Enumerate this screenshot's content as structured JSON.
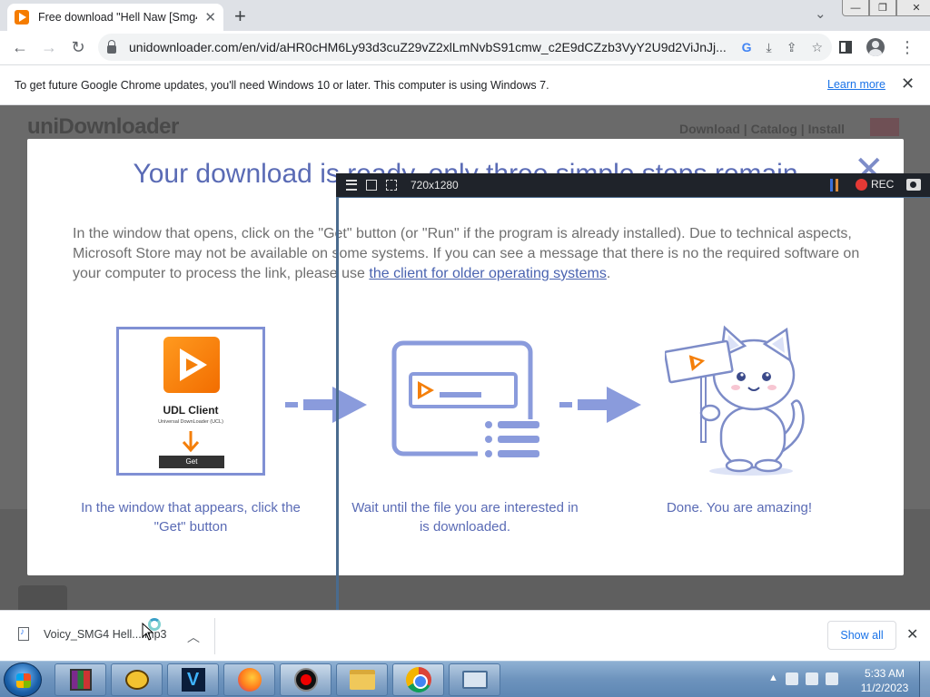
{
  "browser": {
    "tab_title": "Free download \"Hell Naw [Smg4",
    "url": "unidownloader.com/en/vid/aHR0cHM6Ly93d3cuZ29vZ2xlLmNvbS91cmw_c2E9dCZzb3VyY2U9d2ViJnJj...",
    "infobar_text": "To get future Google Chrome updates, you'll need Windows 10 or later. This computer is using Windows 7.",
    "infobar_link": "Learn more"
  },
  "site": {
    "logo": "uniDownloader",
    "nav": "Download | Catalog | Install"
  },
  "modal": {
    "title": "Your download is ready, only three simple steps remain",
    "description": "In the window that opens, click on the \"Get\" button (or \"Run\" if the program is already installed). Due to technical aspects, Microsoft Store may not be available on some systems. If you can see a message that there is no the required software on your computer to process the link, please use ",
    "description_link": "the client for older operating systems",
    "description_end": ".",
    "udl_title": "UDL Client",
    "udl_subtitle": "Universal DownLoader (UCL)",
    "udl_get": "Get",
    "step1_line1": "In the window that appears, click the",
    "step1_line2": "\"Get\" button",
    "step2_line1": "Wait until the file you are interested in",
    "step2_line2": "is downloaded.",
    "step3_line1": "Done. You are amazing!"
  },
  "recorder": {
    "size": "720x1280",
    "rec_label": "REC"
  },
  "downloads": {
    "file_name": "Voicy_SMG4 Hell....mp3",
    "show_all": "Show all"
  },
  "taskbar": {
    "time": "5:33 AM",
    "date": "11/2/2023",
    "app_v_label": "V"
  },
  "colors": {
    "accent_blue": "#5a6bb5",
    "udl_orange": "#f47f0a",
    "chrome_link": "#1a73e8"
  }
}
